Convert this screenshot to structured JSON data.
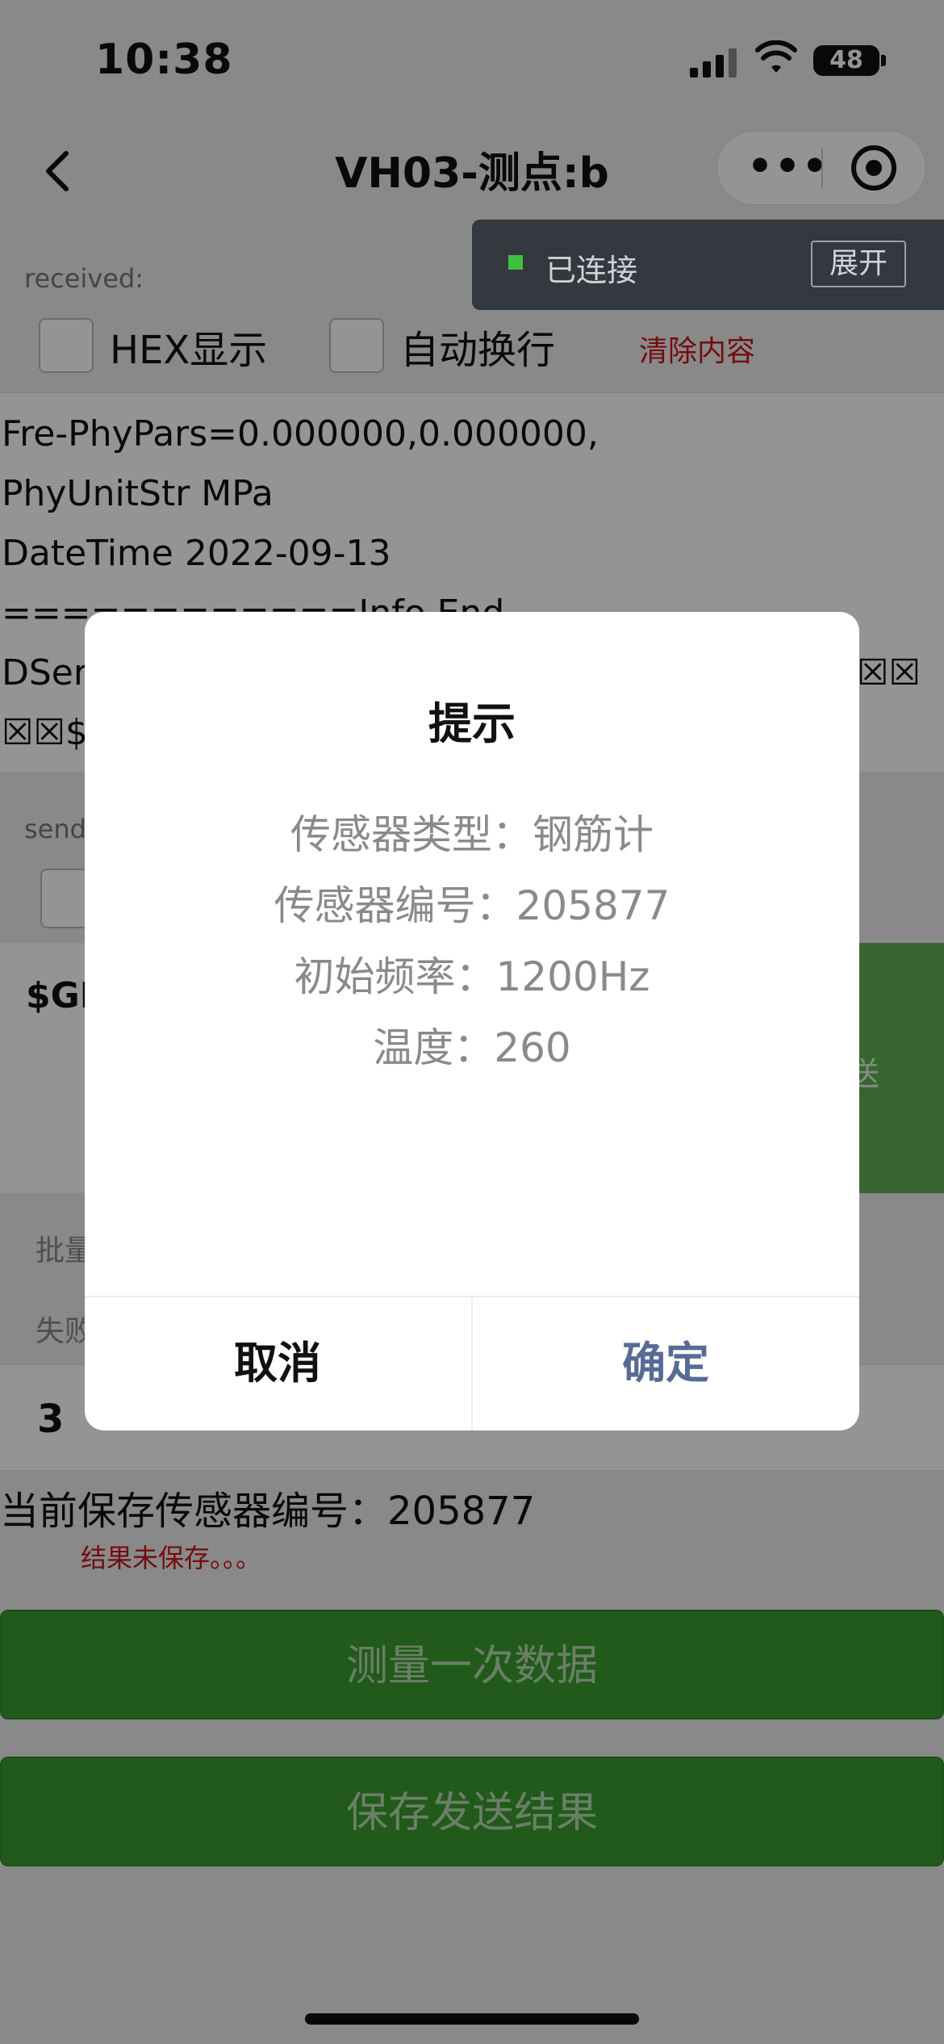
{
  "status_bar": {
    "time": "10:38",
    "battery": "48"
  },
  "nav": {
    "title": "VH03-测点:b"
  },
  "received": {
    "label": "received:",
    "hex_label": "HEX显示",
    "wrap_label": "自动换行",
    "clear_label": "清除内容"
  },
  "log_lines": [
    "Fre-PhyPars=0.000000,0.000000,",
    "PhyUnitStr MPa",
    "DateTime 2022-09-13",
    "============Info End",
    "DSer",
    "☒☒$"
  ],
  "log_tail": "☒☒",
  "send": {
    "label": "send",
    "command_text": "$GI",
    "send_button": "送"
  },
  "batch": {
    "label1": "批量",
    "label2": "失败"
  },
  "number_value": "3",
  "current_saved": "当前保存传感器编号：205877",
  "unsaved_text": "结果未保存。。。",
  "buttons": {
    "measure": "测量一次数据",
    "save": "保存发送结果"
  },
  "toast": {
    "status": "已连接",
    "expand": "展开"
  },
  "dialog": {
    "title": "提示",
    "lines": [
      "传感器类型：钢筋计",
      "传感器编号：205877",
      "初始频率：1200Hz",
      "温度：260"
    ],
    "cancel": "取消",
    "ok": "确定"
  },
  "colors": {
    "ok_button": "#576b95",
    "primary_green": "#3a9b2e",
    "alert_red": "#c8161d"
  }
}
